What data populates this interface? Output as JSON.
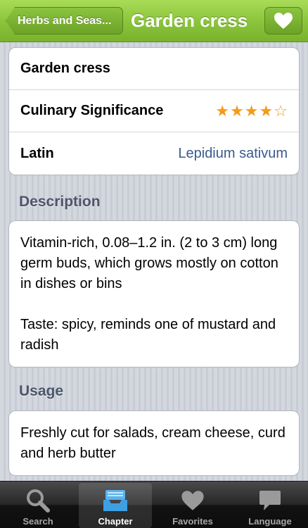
{
  "navbar": {
    "back_label": "Herbs and Seas...",
    "title": "Garden cress"
  },
  "details": {
    "name": "Garden cress",
    "culinary_label": "Culinary Significance",
    "rating": 4,
    "rating_max": 5,
    "latin_label": "Latin",
    "latin_value": "Lepidium sativum"
  },
  "description": {
    "title": "Description",
    "paragraph1": "Vitamin-rich, 0.08–1.2 in. (2 to 3 cm) long germ buds, which grows mostly on cotton in dishes or bins",
    "paragraph2": "Taste: spicy, reminds one of mustard and radish"
  },
  "usage": {
    "title": "Usage",
    "text": "Freshly cut for salads, cream cheese, curd and herb butter"
  },
  "tabs": [
    {
      "label": "Search",
      "icon": "search-icon"
    },
    {
      "label": "Chapter",
      "icon": "inbox-tray-icon"
    },
    {
      "label": "Favorites",
      "icon": "heart-icon"
    },
    {
      "label": "Language",
      "icon": "speech-bubble-icon"
    }
  ],
  "colors": {
    "accent_green": "#8cc63c",
    "star": "#f29b1d",
    "link_blue": "#3a5a8e"
  }
}
